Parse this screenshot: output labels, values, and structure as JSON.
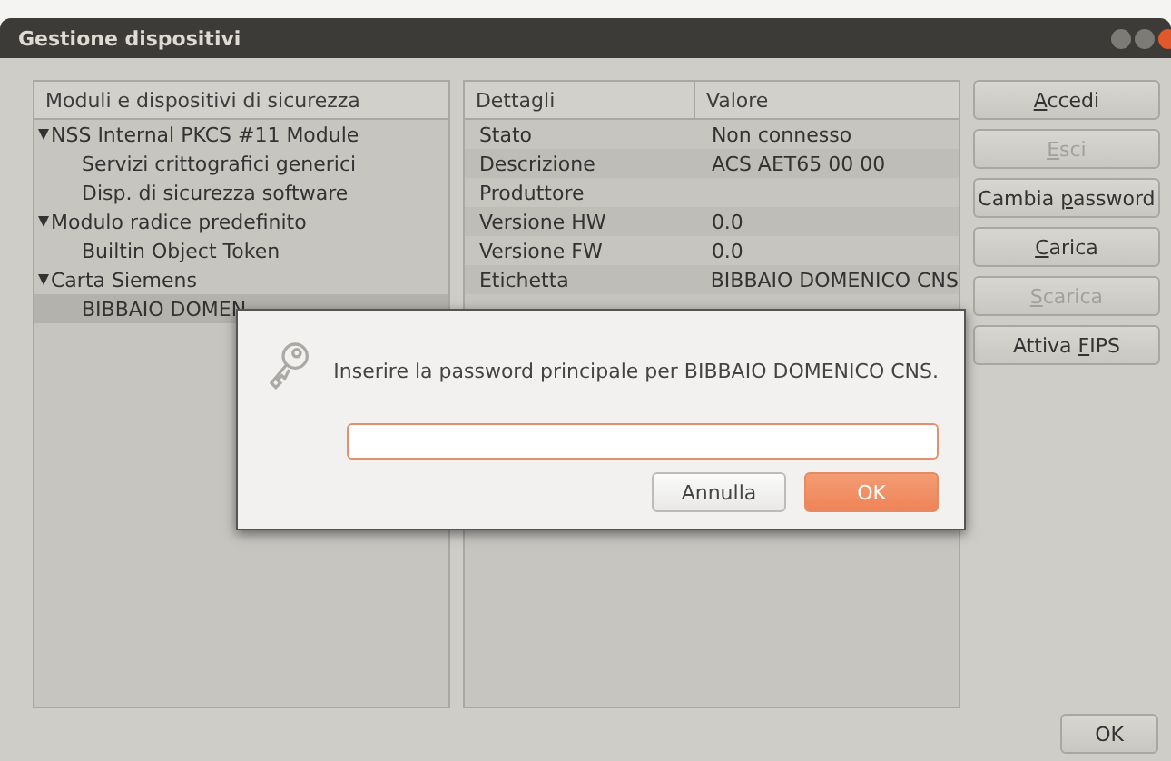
{
  "window": {
    "title": "Gestione dispositivi"
  },
  "tree": {
    "header": "Moduli e dispositivi di sicurezza",
    "items": [
      {
        "label": "NSS Internal PKCS #11 Module",
        "expanded": true,
        "selected": false,
        "children": [
          {
            "label": "Servizi crittografici generici",
            "selected": false
          },
          {
            "label": "Disp. di sicurezza software",
            "selected": false
          }
        ]
      },
      {
        "label": "Modulo radice predefinito",
        "expanded": true,
        "selected": false,
        "children": [
          {
            "label": "Builtin Object Token",
            "selected": false
          }
        ]
      },
      {
        "label": "Carta Siemens",
        "expanded": true,
        "selected": false,
        "children": [
          {
            "label": "BIBBAIO DOMEN",
            "selected": true
          }
        ]
      }
    ]
  },
  "details": {
    "columns": [
      "Dettagli",
      "Valore"
    ],
    "rows": [
      [
        "Stato",
        "Non connesso"
      ],
      [
        "Descrizione",
        "ACS AET65 00 00"
      ],
      [
        "Produttore",
        ""
      ],
      [
        "Versione HW",
        "0.0"
      ],
      [
        "Versione FW",
        "0.0"
      ],
      [
        "Etichetta",
        "BIBBAIO DOMENICO CNS"
      ]
    ]
  },
  "buttons": [
    {
      "key": "A",
      "post": "ccedi",
      "disabled": false
    },
    {
      "key": "E",
      "post": "sci",
      "disabled": true
    },
    {
      "pre": "Cambia ",
      "key": "p",
      "post": "assword",
      "disabled": false
    },
    {
      "key": "C",
      "post": "arica",
      "disabled": false
    },
    {
      "key": "S",
      "post": "carica",
      "disabled": true
    },
    {
      "pre": "Attiva ",
      "key": "F",
      "post": "IPS",
      "disabled": false
    }
  ],
  "ok_button": "OK",
  "dialog": {
    "message": "Inserire la password principale per BIBBAIO DOMENICO CNS.",
    "buttons": [
      {
        "label": "Annulla",
        "default": false
      },
      {
        "label": "OK",
        "default": true
      }
    ]
  }
}
